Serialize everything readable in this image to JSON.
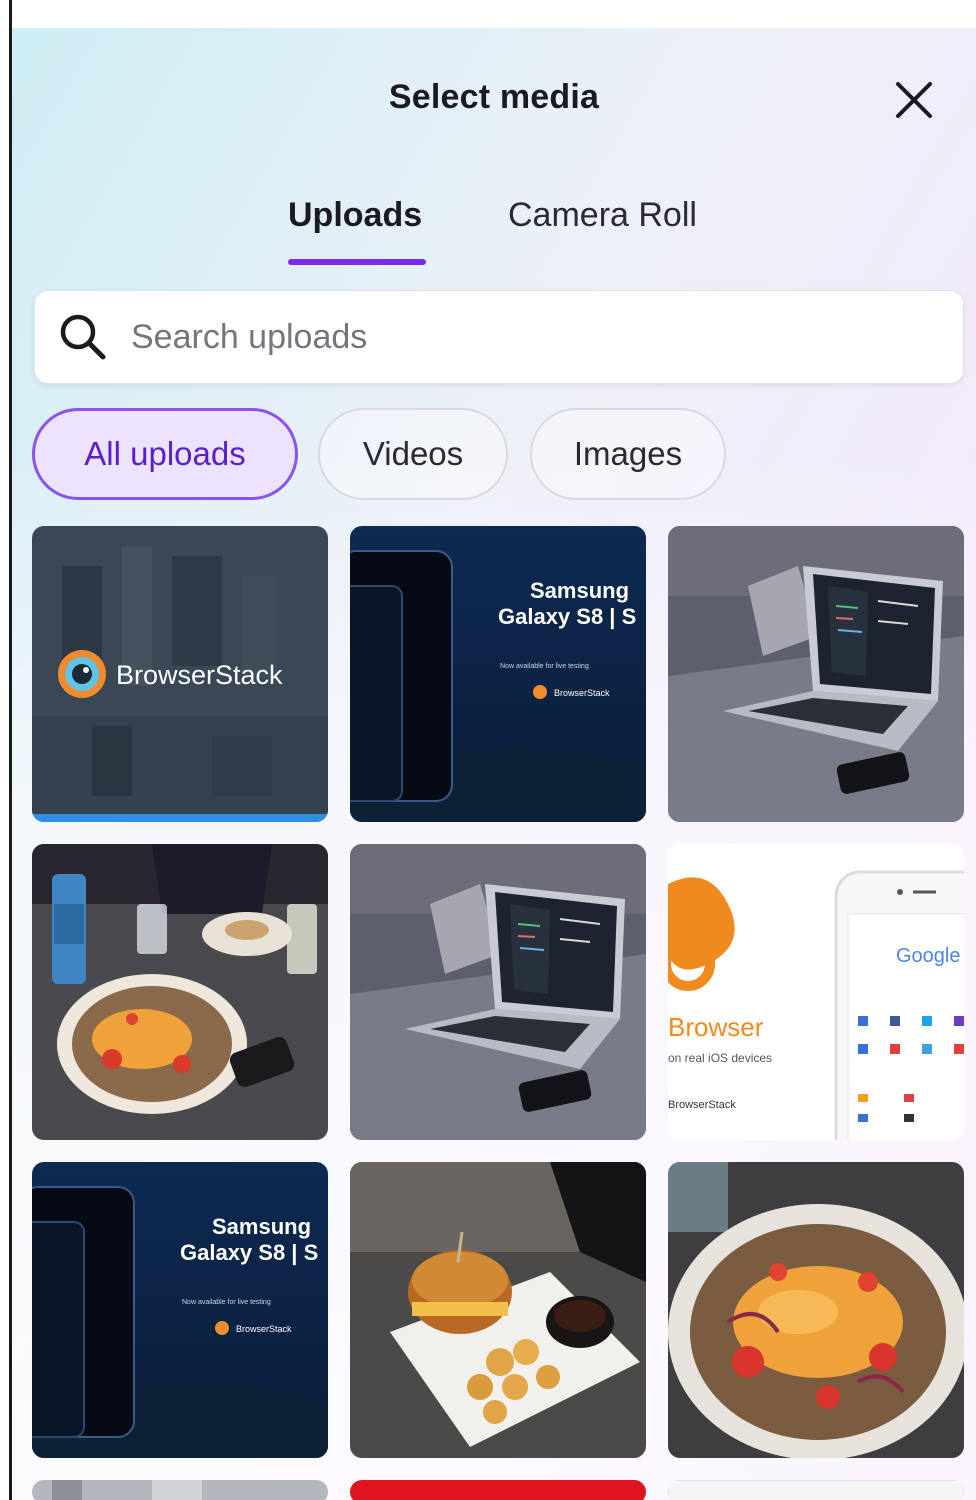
{
  "dialog": {
    "title": "Select media"
  },
  "tabs": [
    {
      "label": "Uploads",
      "active": true
    },
    {
      "label": "Camera Roll",
      "active": false
    }
  ],
  "search": {
    "placeholder": "Search uploads",
    "value": ""
  },
  "filters": [
    {
      "label": "All uploads",
      "active": true
    },
    {
      "label": "Videos",
      "active": false
    },
    {
      "label": "Images",
      "active": false
    }
  ],
  "thumbnails": {
    "browserstack_logo": {
      "text": "BrowserStack"
    },
    "samsung_1": {
      "line1": "Samsung",
      "line2": "Galaxy S8 | S",
      "line3": "Now available for live testing",
      "brand": "BrowserStack"
    },
    "uc_browser": {
      "word": "Browser",
      "sub": "on real iOS devices",
      "brand": "BrowserStack",
      "google": "Google"
    },
    "samsung_2": {
      "line1": "Samsung",
      "line2": "Galaxy S8 | S",
      "line3": "Now available for live testing",
      "brand": "BrowserStack"
    }
  },
  "colors": {
    "accent": "#7d2ae8",
    "chip_active_bg": "#ece4ff",
    "progress_bar": "#2f8fe6"
  },
  "icons": {
    "close": "close-icon",
    "search": "search-icon"
  }
}
